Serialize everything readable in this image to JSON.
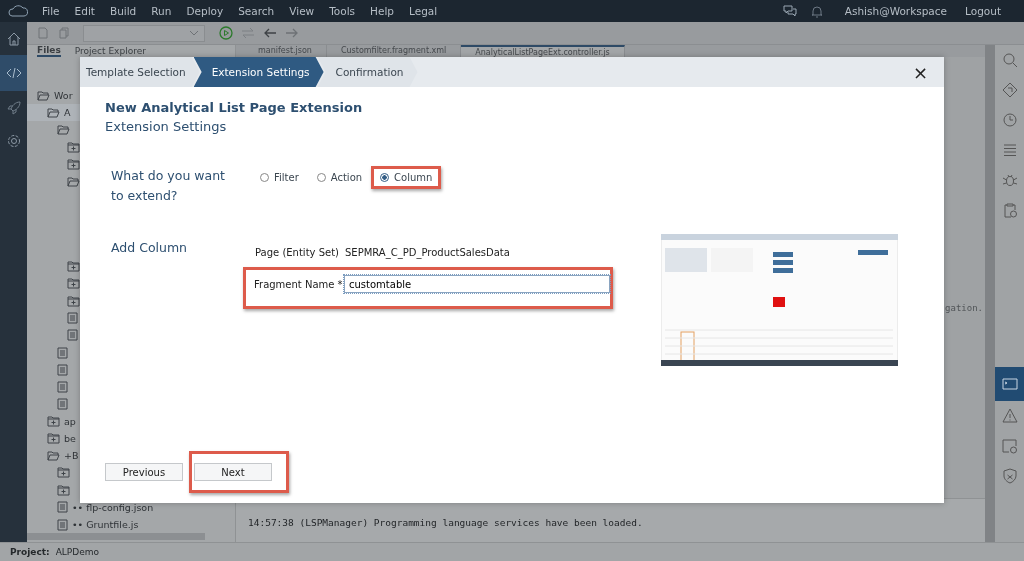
{
  "menu": [
    "File",
    "Edit",
    "Build",
    "Run",
    "Deploy",
    "Search",
    "View",
    "Tools",
    "Help",
    "Legal"
  ],
  "user": {
    "name": "Ashish@Workspace",
    "logout": "Logout"
  },
  "left_rail": [
    {
      "kind": "home",
      "selected": false
    },
    {
      "kind": "code",
      "selected": true
    },
    {
      "kind": "rocket",
      "selected": false
    },
    {
      "kind": "gear",
      "selected": false
    }
  ],
  "right_rail": [
    {
      "kind": "search",
      "selected": false
    },
    {
      "kind": "diamond",
      "selected": false
    },
    {
      "kind": "clock",
      "selected": false
    },
    {
      "kind": "list",
      "selected": false
    },
    {
      "kind": "bug",
      "selected": false
    },
    {
      "kind": "clipboard",
      "selected": false
    },
    {
      "kind": "terminal",
      "selected": true
    },
    {
      "kind": "warning",
      "selected": false
    },
    {
      "kind": "preview",
      "selected": false
    },
    {
      "kind": "shield",
      "selected": false
    }
  ],
  "panel_tabs": [
    {
      "label": "Files",
      "selected": true
    },
    {
      "label": "Project Explorer",
      "selected": false
    }
  ],
  "editor_tabs": [
    {
      "label": "manifest.json",
      "selected": false
    },
    {
      "label": "Customfilter.fragment.xml",
      "selected": false
    },
    {
      "label": "AnalyticalListPageExt.controller.js",
      "selected": true
    }
  ],
  "tree": [
    {
      "kind": "folder",
      "label": "Wor",
      "expanded": true,
      "selected": false,
      "children": [
        {
          "kind": "folder",
          "label": "A",
          "expanded": true,
          "selected": true,
          "children": [
            {
              "kind": "folder",
              "expanded": true,
              "selected": false,
              "children": [
                {
                  "kind": "folder",
                  "expanded": false,
                  "selected": false
                },
                {
                  "kind": "folder",
                  "expanded": false,
                  "selected": false
                },
                {
                  "kind": "folder",
                  "expanded": true,
                  "selected": false
                },
                {
                  "kind": "folder",
                  "expanded": false,
                  "selected": false
                },
                {
                  "kind": "folder",
                  "expanded": false,
                  "selected": false
                },
                {
                  "kind": "folder",
                  "expanded": false,
                  "selected": false
                },
                {
                  "kind": "file",
                  "selected": false
                },
                {
                  "kind": "file",
                  "selected": false
                }
              ]
            },
            {
              "kind": "file",
              "selected": false
            },
            {
              "kind": "file",
              "selected": false
            },
            {
              "kind": "file",
              "selected": false
            },
            {
              "kind": "file",
              "selected": false
            }
          ]
        },
        {
          "kind": "folder",
          "label": "ap",
          "expanded": false,
          "selected": false
        },
        {
          "kind": "folder",
          "label": "be",
          "expanded": false,
          "selected": false
        },
        {
          "kind": "folder",
          "label": "+B",
          "expanded": true,
          "selected": false,
          "children": [
            {
              "kind": "folder",
              "expanded": false,
              "selected": false
            },
            {
              "kind": "folder",
              "expanded": false,
              "selected": false
            },
            {
              "kind": "file",
              "label": "•• flp-config.json",
              "selected": false
            },
            {
              "kind": "file",
              "label": "•• Gruntfile.js",
              "selected": false
            }
          ]
        }
      ]
    }
  ],
  "editor_text": "gation.",
  "console": [
    "14:57:38 (LSPManager) Programming language services have been loaded."
  ],
  "status_bar": {
    "label": "Project:",
    "value": "ALPDemo"
  },
  "dialog": {
    "steps": [
      {
        "label": "Template Selection",
        "selected": false
      },
      {
        "label": "Extension Settings",
        "selected": true
      },
      {
        "label": "Confirmation",
        "selected": false
      }
    ],
    "close": "×",
    "title": "New Analytical List Page Extension",
    "subtitle": "Extension Settings",
    "question": "What do you want to extend?",
    "options": [
      {
        "label": "Filter",
        "selected": false,
        "highlighted": false
      },
      {
        "label": "Action",
        "selected": false,
        "highlighted": false
      },
      {
        "label": "Column",
        "selected": true,
        "highlighted": true
      }
    ],
    "section": "Add Column",
    "page_label": "Page (Entity Set)",
    "page_value": "SEPMRA_C_PD_ProductSalesData",
    "fragment": {
      "label": "Fragment Name *",
      "value": "customtable",
      "highlighted": true
    },
    "buttons": [
      {
        "label": "Previous",
        "highlighted": false
      },
      {
        "label": "Next",
        "highlighted": true
      }
    ]
  }
}
